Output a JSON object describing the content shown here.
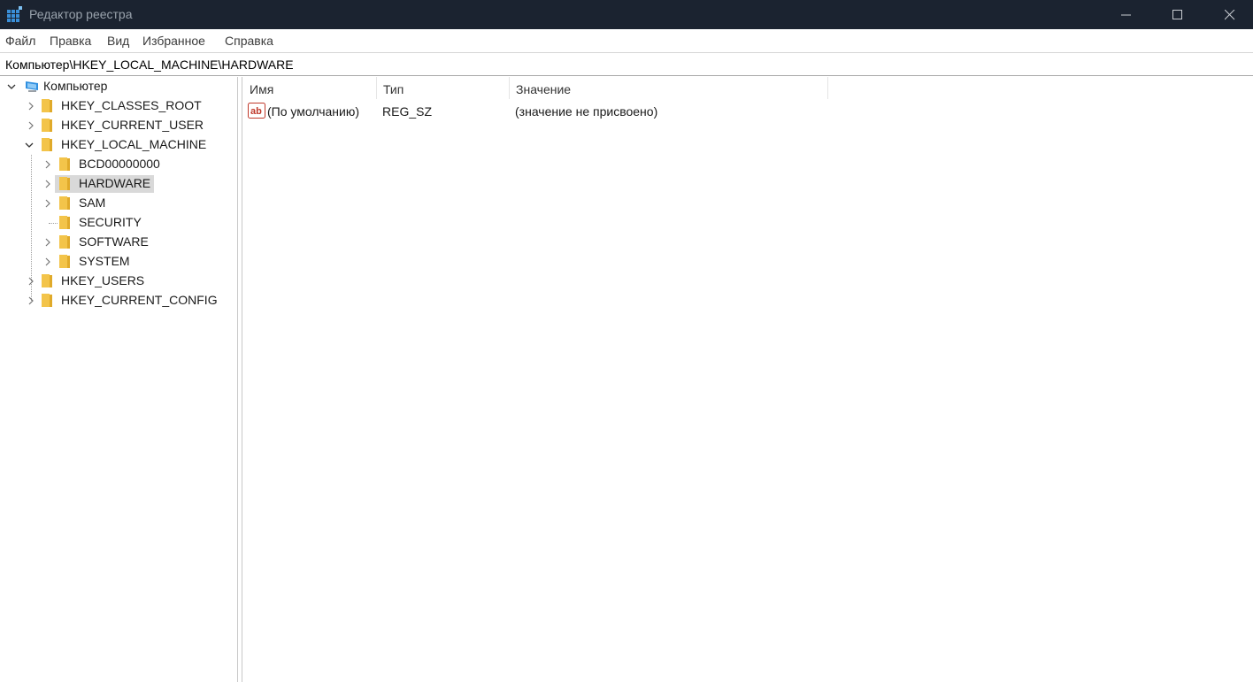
{
  "window": {
    "title": "Редактор реестра"
  },
  "menu": {
    "items": [
      "Файл",
      "Правка",
      "Вид",
      "Избранное",
      "Справка"
    ]
  },
  "address": {
    "path": "Компьютер\\HKEY_LOCAL_MACHINE\\HARDWARE"
  },
  "tree": {
    "root": "Компьютер",
    "hives": {
      "classes_root": "HKEY_CLASSES_ROOT",
      "current_user": "HKEY_CURRENT_USER",
      "local_machine": "HKEY_LOCAL_MACHINE",
      "users": "HKEY_USERS",
      "current_config": "HKEY_CURRENT_CONFIG"
    },
    "local_machine_children": [
      "BCD00000000",
      "HARDWARE",
      "SAM",
      "SECURITY",
      "SOFTWARE",
      "SYSTEM"
    ],
    "selected": "HARDWARE"
  },
  "list": {
    "columns": {
      "name": "Имя",
      "type": "Тип",
      "value": "Значение"
    },
    "rows": [
      {
        "name": "(По умолчанию)",
        "type": "REG_SZ",
        "value": "(значение не присвоено)",
        "icon": "string-value-icon"
      }
    ]
  },
  "colors": {
    "titlebar": "#1b2330",
    "folder": "#f3c44a",
    "selection": "#d9d9d9"
  }
}
